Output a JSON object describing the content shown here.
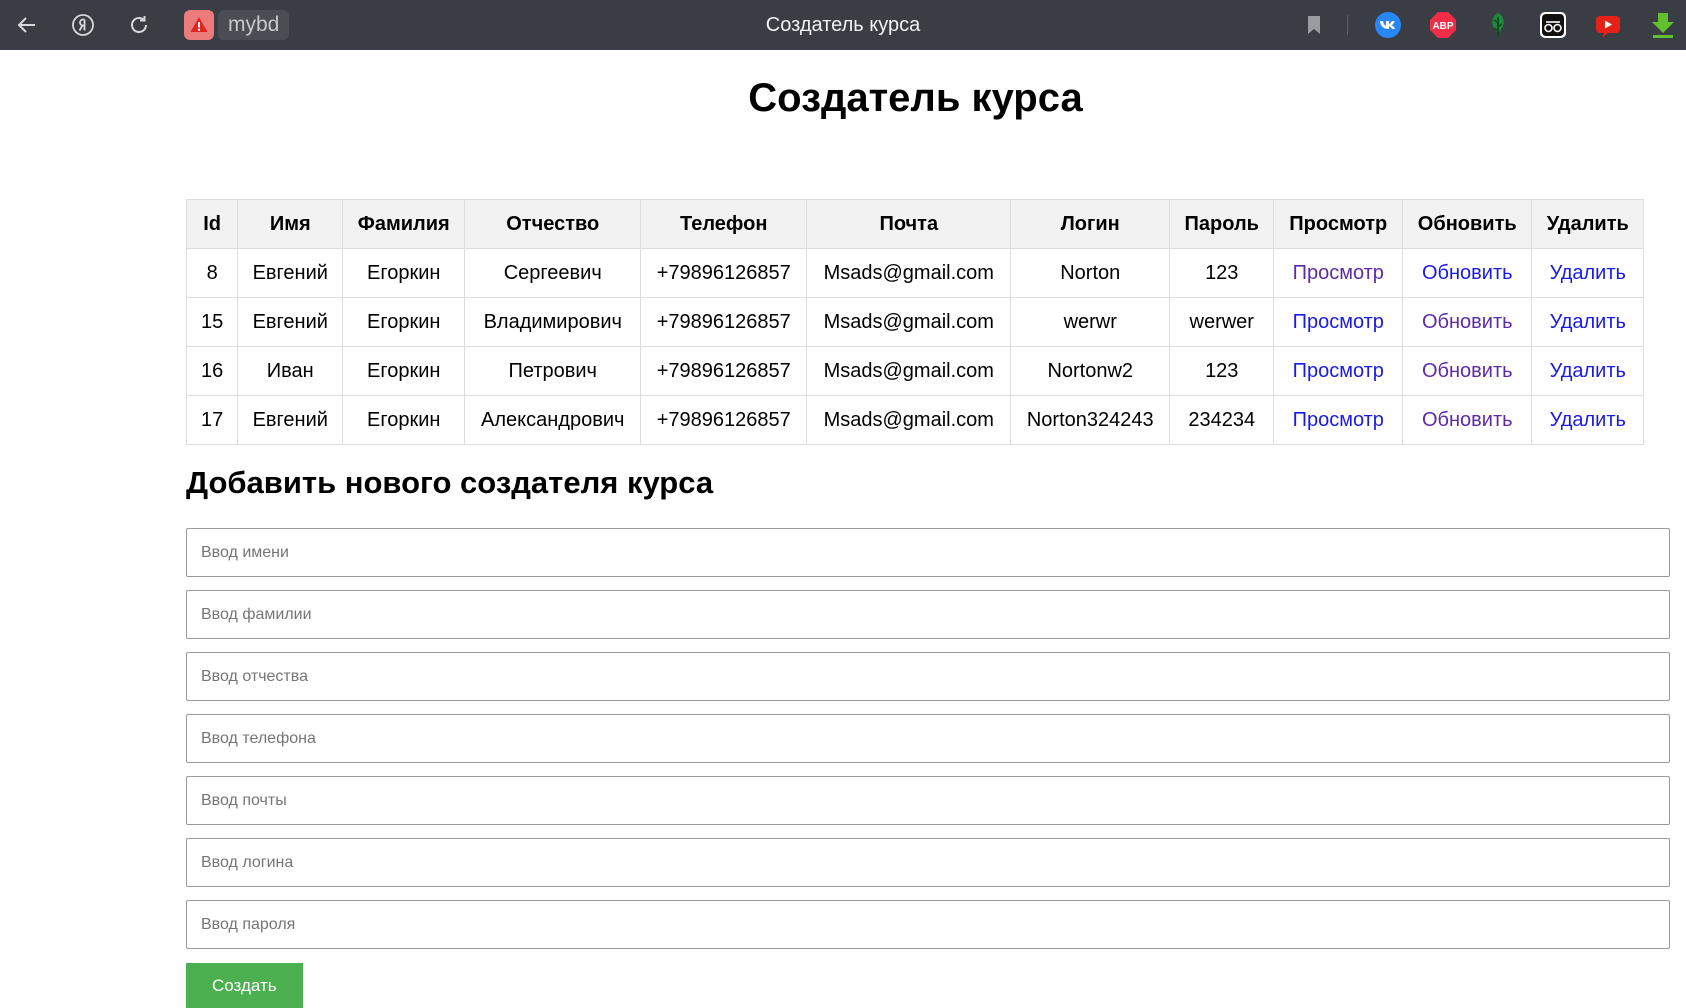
{
  "browser": {
    "site_name": "mybd",
    "tab_title": "Создатель курса",
    "extensions": [
      "bookmark-icon",
      "vk-icon",
      "adblock-icon",
      "leaf-icon",
      "reader-icon",
      "youtube-icon",
      "download-icon"
    ],
    "abp_label": "ABP"
  },
  "page": {
    "title": "Создатель курса",
    "table": {
      "headers": [
        "Id",
        "Имя",
        "Фамилия",
        "Отчество",
        "Телефон",
        "Почта",
        "Логин",
        "Пароль",
        "Просмотр",
        "Обновить",
        "Удалить"
      ],
      "rows": [
        {
          "id": "8",
          "first": "Евгений",
          "last": "Егоркин",
          "middle": "Сергеевич",
          "phone": "+79896126857",
          "email": "Msads@gmail.com",
          "login": "Norton",
          "password": "123",
          "view": "Просмотр",
          "update": "Обновить",
          "delete": "Удалить"
        },
        {
          "id": "15",
          "first": "Евгений",
          "last": "Егоркин",
          "middle": "Владимирович",
          "phone": "+79896126857",
          "email": "Msads@gmail.com",
          "login": "werwr",
          "password": "werwer",
          "view": "Просмотр",
          "update": "Обновить",
          "delete": "Удалить"
        },
        {
          "id": "16",
          "first": "Иван",
          "last": "Егоркин",
          "middle": "Петрович",
          "phone": "+79896126857",
          "email": "Msads@gmail.com",
          "login": "Nortonw2",
          "password": "123",
          "view": "Просмотр",
          "update": "Обновить",
          "delete": "Удалить"
        },
        {
          "id": "17",
          "first": "Евгений",
          "last": "Егоркин",
          "middle": "Александрович",
          "phone": "+79896126857",
          "email": "Msads@gmail.com",
          "login": "Norton324243",
          "password": "234234",
          "view": "Просмотр",
          "update": "Обновить",
          "delete": "Удалить"
        }
      ]
    },
    "add_section_title": "Добавить нового создателя курса",
    "form": {
      "first_name_placeholder": "Ввод имени",
      "last_name_placeholder": "Ввод фамилии",
      "middle_name_placeholder": "Ввод отчества",
      "phone_placeholder": "Ввод телефона",
      "email_placeholder": "Ввод почты",
      "login_placeholder": "Ввод логина",
      "password_placeholder": "Ввод пароля",
      "submit_label": "Создать"
    }
  },
  "colors": {
    "chrome_bg": "#3b3d45",
    "link": "#1a1ae6",
    "visited_link": "#5d2aa8",
    "button": "#4caf50",
    "header_bg": "#f2f2f2"
  }
}
